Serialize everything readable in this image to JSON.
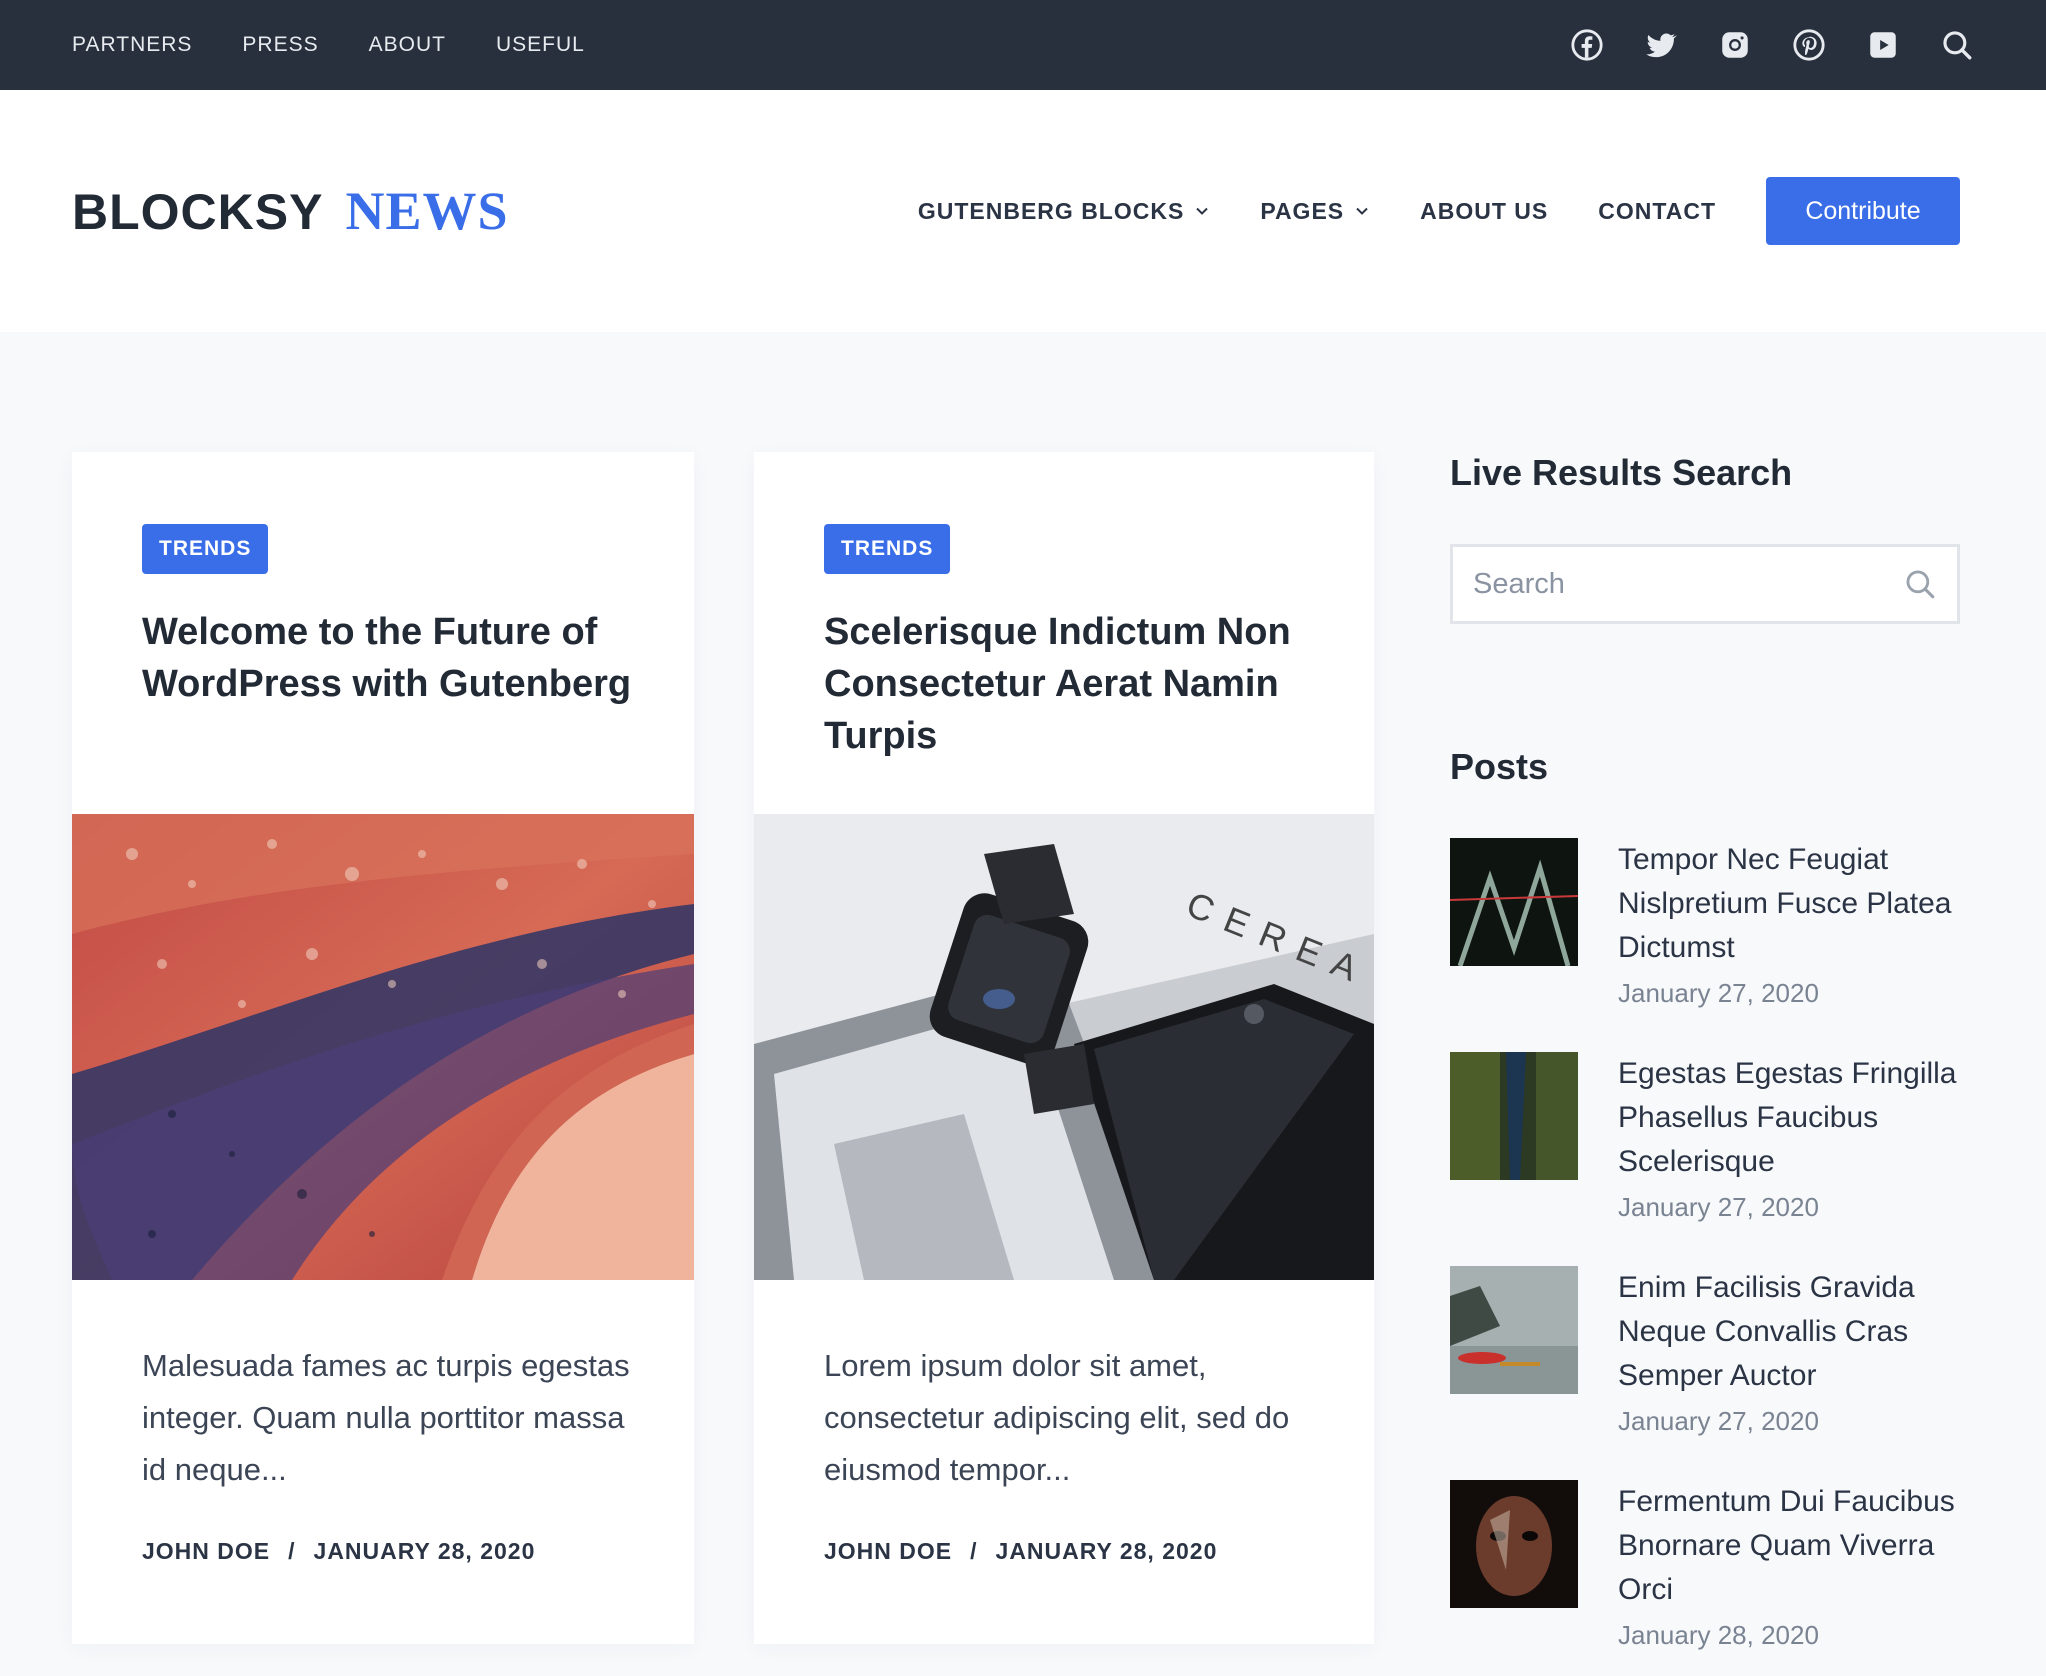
{
  "topbar": {
    "menu": [
      "PARTNERS",
      "PRESS",
      "ABOUT",
      "USEFUL"
    ],
    "icons": [
      "facebook-icon",
      "twitter-icon",
      "instagram-icon",
      "pinterest-icon",
      "youtube-icon",
      "search-icon"
    ]
  },
  "header": {
    "logo_part1": "BLOCKSY",
    "logo_part2": "NEWS",
    "nav": [
      "GUTENBERG BLOCKS",
      "PAGES",
      "ABOUT US",
      "CONTACT"
    ],
    "contribute_label": "Contribute"
  },
  "cards": [
    {
      "badge": "TRENDS",
      "title": "Welcome to the Future of WordPress with Gutenberg",
      "excerpt": "Malesuada fames ac turpis egestas integer. Quam nulla porttitor massa id neque...",
      "author": "JOHN DOE",
      "separator": "/",
      "date": "JANUARY 28, 2020"
    },
    {
      "badge": "TRENDS",
      "title": "Scelerisque Indictum Non Consectetur Aerat Namin Turpis",
      "excerpt": "Lorem ipsum dolor sit amet, consectetur adipiscing elit, sed do eiusmod tempor...",
      "author": "JOHN DOE",
      "separator": "/",
      "date": "JANUARY 28, 2020"
    }
  ],
  "sidebar": {
    "search_title": "Live Results Search",
    "search_placeholder": "Search",
    "posts_title": "Posts",
    "posts": [
      {
        "title": "Tempor Nec Feugiat Nislpretium Fusce Platea Dictumst",
        "date": "January 27, 2020"
      },
      {
        "title": "Egestas Egestas Fringilla Phasellus Faucibus Scelerisque",
        "date": "January 27, 2020"
      },
      {
        "title": "Enim Facilisis Gravida Neque Convallis Cras Semper Auctor",
        "date": "January 27, 2020"
      },
      {
        "title": "Fermentum Dui Faucibus Bnornare Quam Viverra Orci",
        "date": "January 28, 2020"
      }
    ]
  },
  "colors": {
    "accent": "#3a6ee8",
    "topbar_bg": "#28303d",
    "heading": "#222a36"
  }
}
